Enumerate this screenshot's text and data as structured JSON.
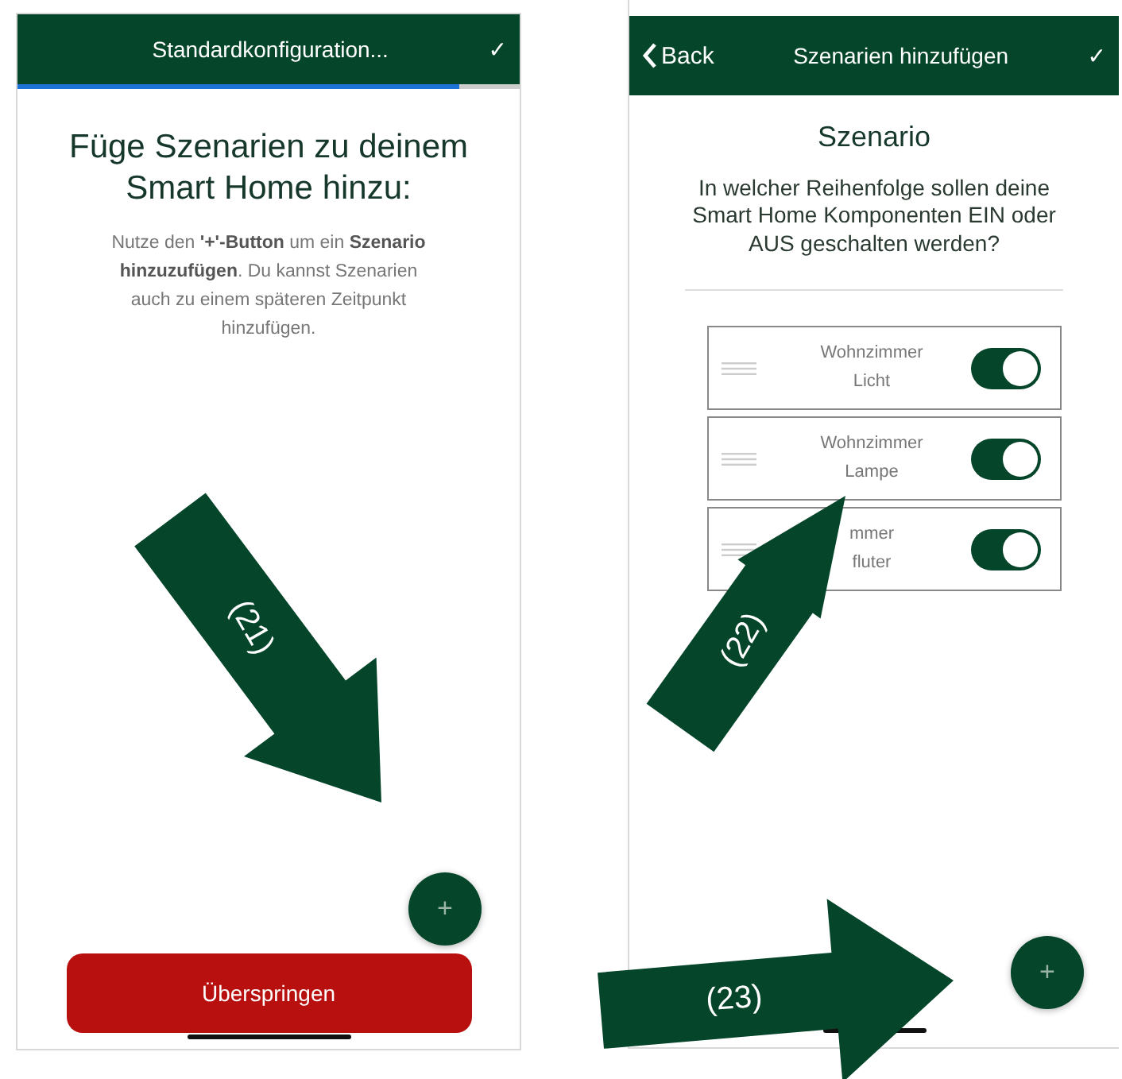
{
  "screens": [
    {
      "kind": "intro",
      "header": {
        "title": "Standardkonfiguration...",
        "confirm": "✓"
      },
      "progress": {
        "level": 0.88
      },
      "heading": "Füge Szenarien zu deinem Smart Home hinzu:",
      "description": "Nutze den **'+'-Button** um ein **Szenario hinzuzufügen**. Du kannst Szenarien auch zu einem späteren Zeitpunkt hinzufügen.",
      "fab": "+",
      "skip_button": "Überspringen"
    },
    {
      "kind": "scenario",
      "header": {
        "back": "Back",
        "title": "Szenarien hinzufügen",
        "confirm": "✓"
      },
      "heading": "Szenario",
      "question": "In welcher Reihenfolge sollen deine Smart Home Komponenten EIN oder AUS geschalten werden?",
      "devices": [
        {
          "line_1": "Wohnzimmer",
          "line_2": "Licht",
          "on": true
        },
        {
          "line_1": "Wohnzimmer",
          "line_2": "Lampe",
          "on": true
        },
        {
          "line_1": "mmer",
          "line_2": "fluter",
          "on": true
        }
      ],
      "fab": "+"
    }
  ],
  "annotations": [
    {
      "label": "(21)"
    },
    {
      "label": "(22)"
    },
    {
      "label": "(23)"
    }
  ]
}
